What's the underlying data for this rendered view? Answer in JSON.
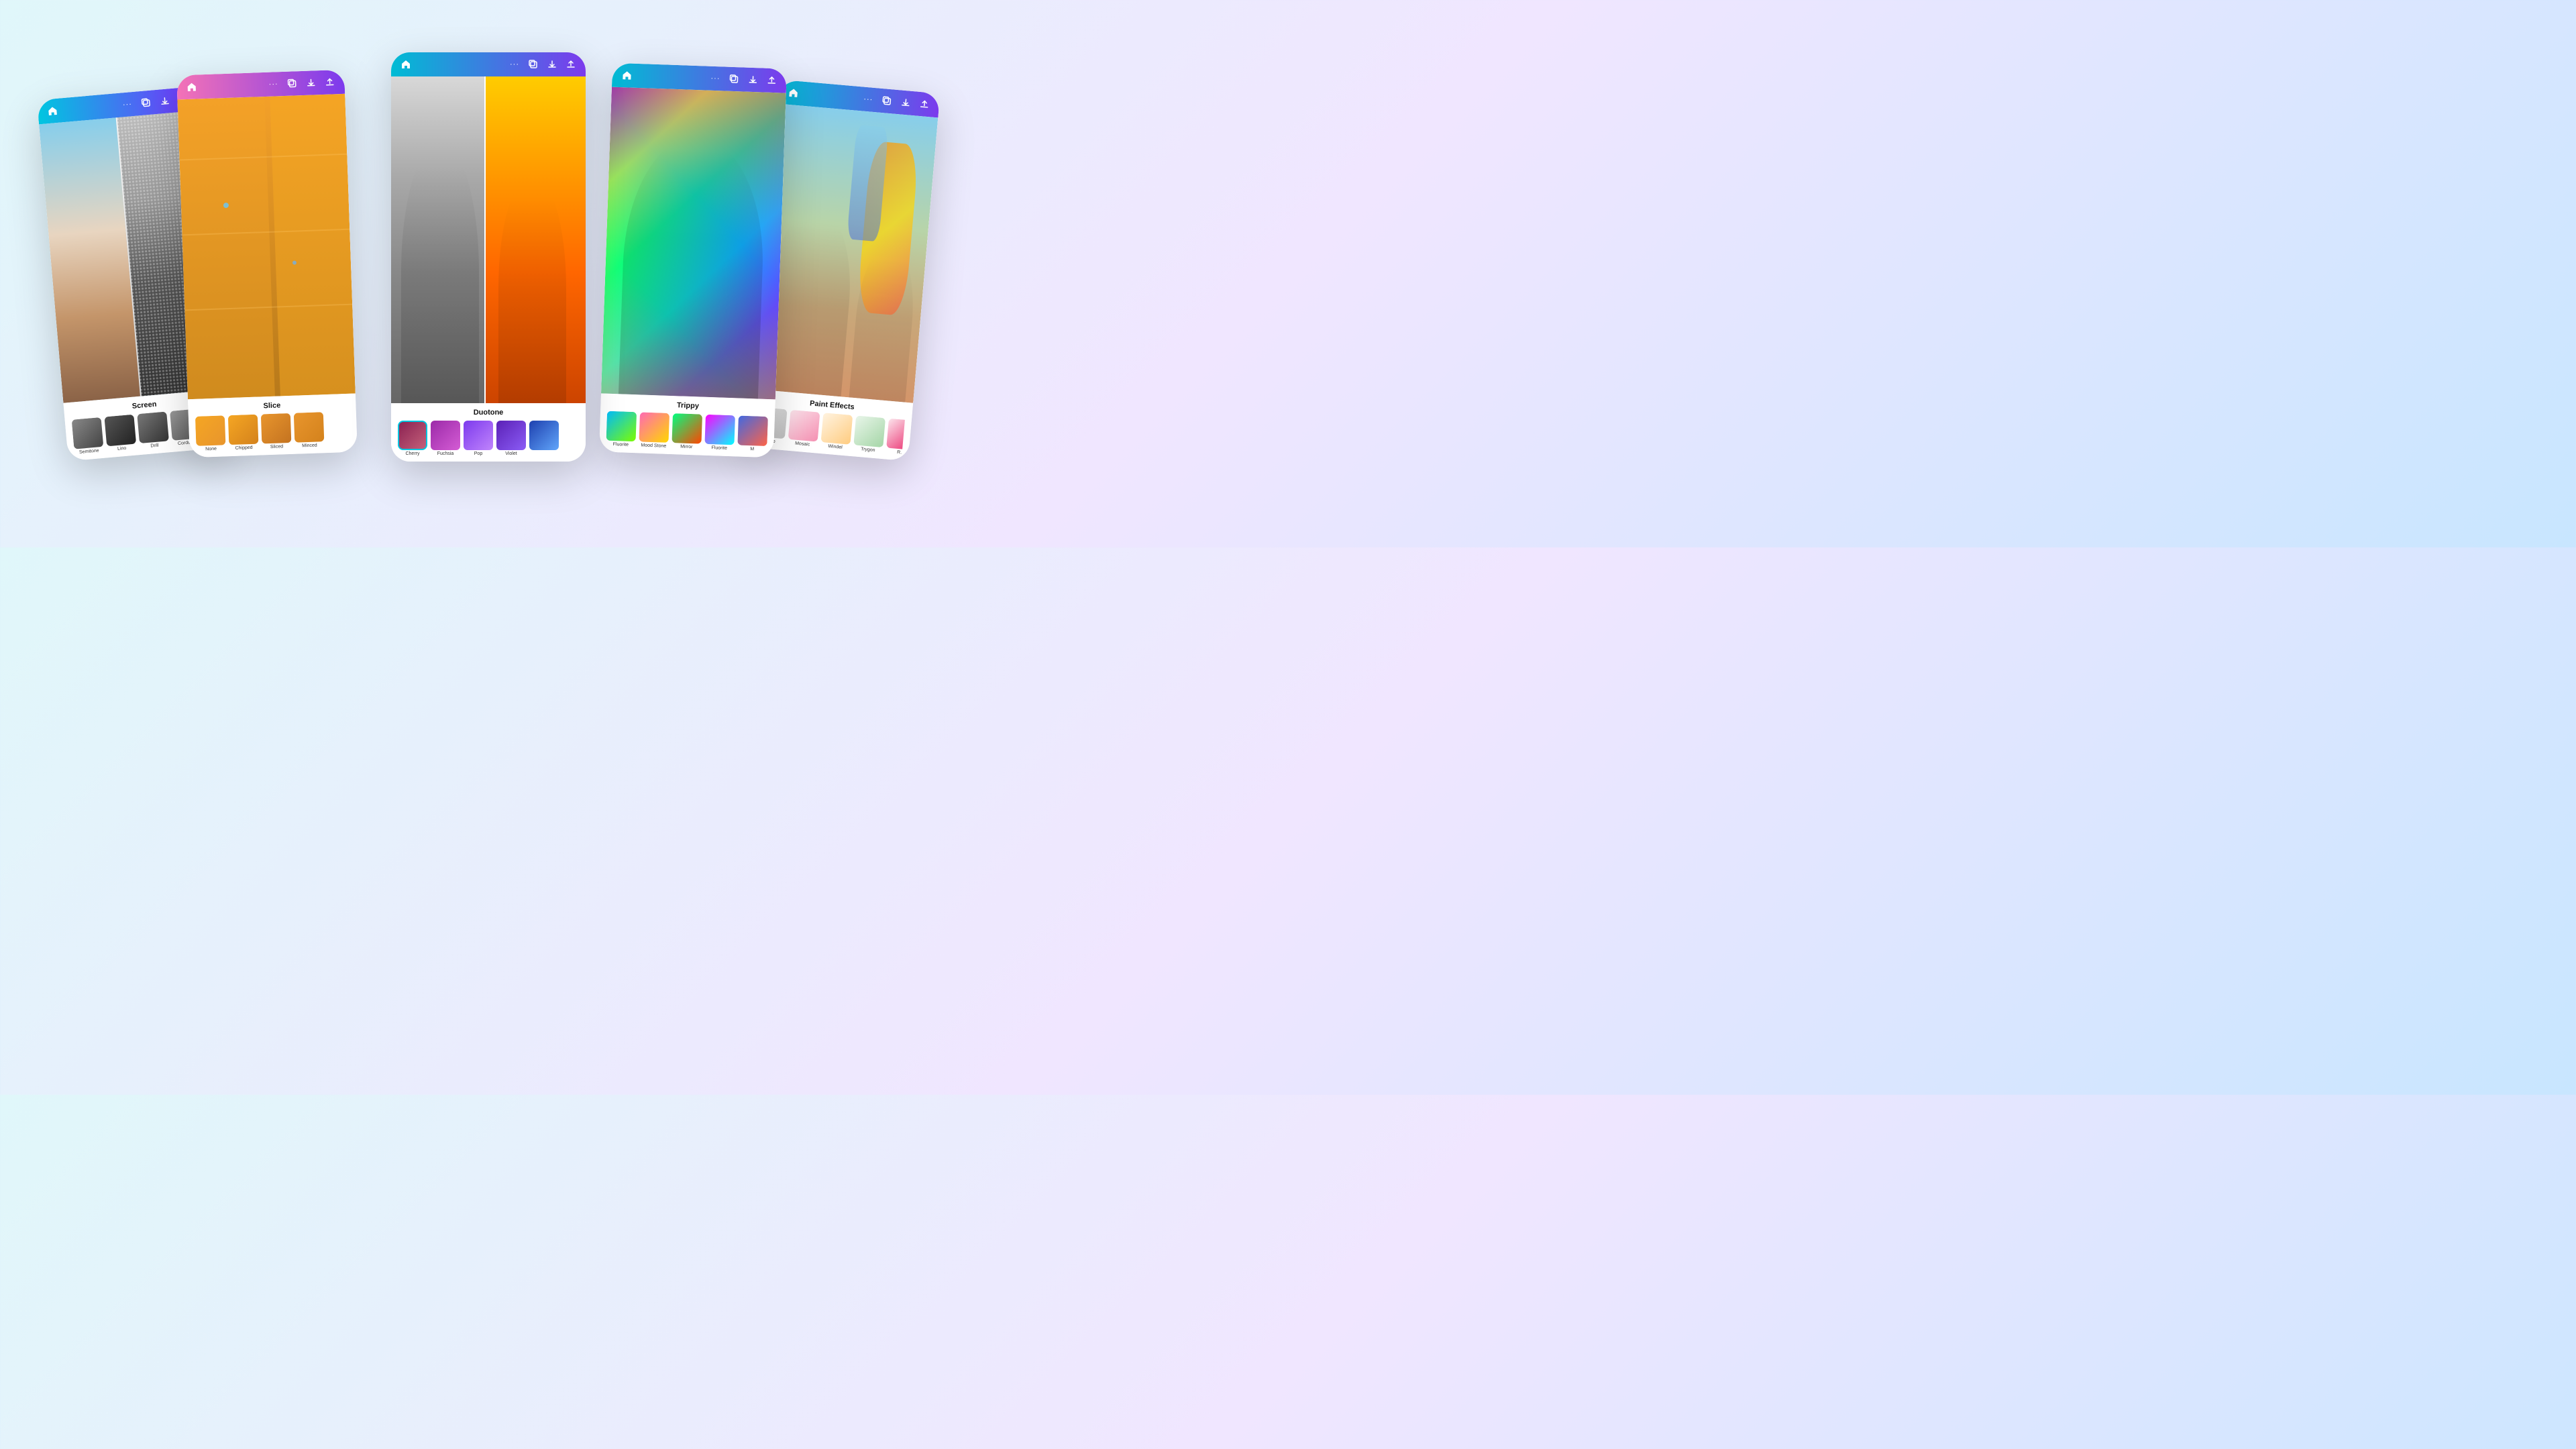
{
  "background": {
    "gradient": "linear-gradient(135deg, #e0f7fa 0%, #f0e6ff 50%, #c8e6ff 100%)"
  },
  "cards": [
    {
      "id": "card-1",
      "effect_name": "Screen",
      "thumbnails": [
        {
          "label": "Semitone",
          "selected": false
        },
        {
          "label": "Lino",
          "selected": false
        },
        {
          "label": "Drill",
          "selected": false
        },
        {
          "label": "Corduroy",
          "selected": false
        }
      ]
    },
    {
      "id": "card-2",
      "effect_name": "Slice",
      "thumbnails": [
        {
          "label": "None",
          "selected": false
        },
        {
          "label": "Chipped",
          "selected": false
        },
        {
          "label": "Sliced",
          "selected": false
        },
        {
          "label": "Minced",
          "selected": false
        }
      ]
    },
    {
      "id": "card-3",
      "effect_name": "Duotone",
      "thumbnails": [
        {
          "label": "Cherry",
          "selected": true
        },
        {
          "label": "Fuchsia",
          "selected": false
        },
        {
          "label": "Pop",
          "selected": false
        },
        {
          "label": "Violet",
          "selected": false
        },
        {
          "label": "",
          "selected": false
        }
      ]
    },
    {
      "id": "card-4",
      "effect_name": "Trippy",
      "thumbnails": [
        {
          "label": "Fluorite",
          "selected": false
        },
        {
          "label": "Mood Stone",
          "selected": false
        },
        {
          "label": "Mirror",
          "selected": false
        },
        {
          "label": "Fluorite",
          "selected": false
        },
        {
          "label": "M",
          "selected": false
        }
      ]
    },
    {
      "id": "card-5",
      "effect_name": "Paint Effects",
      "thumbnails": [
        {
          "label": "None",
          "selected": false
        },
        {
          "label": "Mosaic",
          "selected": false
        },
        {
          "label": "Windel",
          "selected": false
        },
        {
          "label": "Trygon",
          "selected": false
        },
        {
          "label": "R...",
          "selected": false
        }
      ]
    }
  ],
  "icons": {
    "home": "🏠",
    "more": "···",
    "copy": "⧉",
    "download": "⬇",
    "share": "↑"
  }
}
